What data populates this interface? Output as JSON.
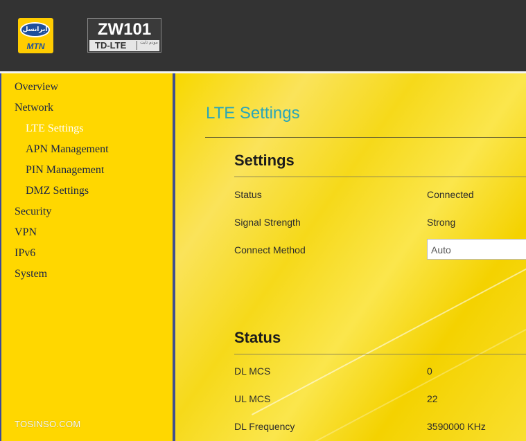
{
  "header": {
    "brand_arabic": "ایرانسل",
    "brand_name": "MTN",
    "model_name": "ZW101",
    "model_sub": "TD-LTE",
    "model_sub_arabic": "مودم ثابت"
  },
  "sidebar": {
    "items": [
      {
        "label": "Overview"
      },
      {
        "label": "Network"
      },
      {
        "label": "LTE Settings"
      },
      {
        "label": "APN Management"
      },
      {
        "label": "PIN Management"
      },
      {
        "label": "DMZ Settings"
      },
      {
        "label": "Security"
      },
      {
        "label": "VPN"
      },
      {
        "label": "IPv6"
      },
      {
        "label": "System"
      }
    ],
    "watermark": "TOSINSO.COM"
  },
  "main": {
    "page_title": "LTE Settings",
    "settings": {
      "title": "Settings",
      "status_label": "Status",
      "status_value": "Connected",
      "signal_label": "Signal Strength",
      "signal_value": "Strong",
      "connect_label": "Connect Method",
      "connect_value": "Auto"
    },
    "status": {
      "title": "Status",
      "rows": [
        {
          "label": "DL MCS",
          "value": "0"
        },
        {
          "label": "UL MCS",
          "value": "22"
        },
        {
          "label": "DL Frequency",
          "value": "3590000 KHz"
        }
      ]
    }
  },
  "colors": {
    "header_bg": "#333333",
    "sidebar_bg": "#ffd700",
    "title_accent": "#2aa6b8",
    "divider": "#3f4f8f"
  }
}
